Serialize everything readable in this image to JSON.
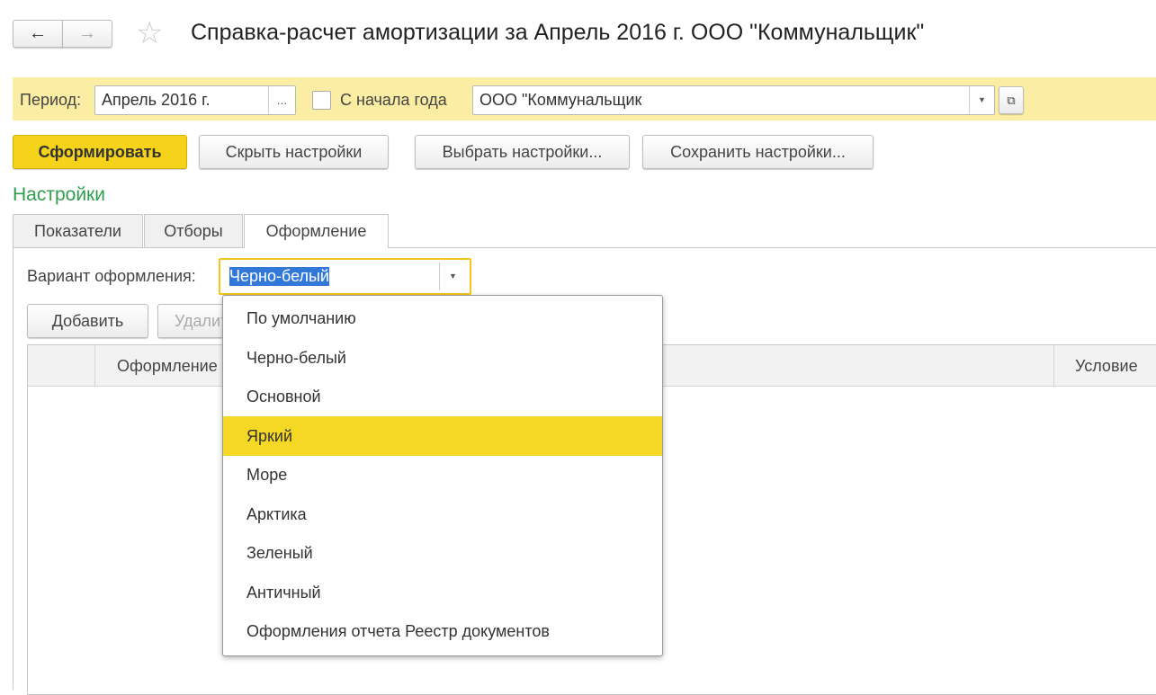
{
  "header": {
    "title": "Справка-расчет амортизации за Апрель 2016 г. ООО \"Коммунальщик\"",
    "back_icon": "arrow-left-icon",
    "forward_icon": "arrow-right-icon",
    "favorite_icon": "star-icon"
  },
  "filter": {
    "period_label": "Период:",
    "period_value": "Апрель 2016 г.",
    "period_button": "...",
    "from_year_label": "С начала года",
    "from_year_checked": false,
    "org_value": "ООО \"Коммунальщик"
  },
  "toolbar": {
    "generate": "Сформировать",
    "hide_settings": "Скрыть настройки",
    "choose_settings": "Выбрать настройки...",
    "save_settings": "Сохранить настройки..."
  },
  "settings": {
    "title": "Настройки",
    "tabs": [
      {
        "label": "Показатели"
      },
      {
        "label": "Отборы"
      },
      {
        "label": "Оформление",
        "active": true
      }
    ],
    "variant_label": "Вариант оформления:",
    "variant_value": "Черно-белый",
    "add": "Добавить",
    "delete": "Удалить",
    "columns": [
      "Оформление",
      "Условие"
    ]
  },
  "dropdown": {
    "options": [
      "По умолчанию",
      "Черно-белый",
      "Основной",
      "Яркий",
      "Море",
      "Арктика",
      "Зеленый",
      "Античный",
      "Оформления отчета Реестр документов"
    ],
    "highlighted": "Яркий"
  },
  "colors": {
    "accent_yellow": "#f5d31b",
    "band": "#fbeda3",
    "green_title": "#2e9e4e",
    "selection": "#3178d8"
  }
}
